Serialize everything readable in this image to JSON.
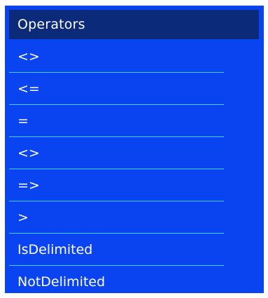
{
  "panel": {
    "title": "Operators"
  },
  "operators": [
    {
      "label": "<>"
    },
    {
      "label": "<="
    },
    {
      "label": "="
    },
    {
      "label": "<>"
    },
    {
      "label": "=>"
    },
    {
      "label": ">"
    },
    {
      "label": "IsDelimited"
    },
    {
      "label": "NotDelimited"
    }
  ],
  "colors": {
    "panel_background": "#0a44f0",
    "header_background": "#0b2a7a",
    "divider": "#41d0ff",
    "text": "#ffffff"
  }
}
